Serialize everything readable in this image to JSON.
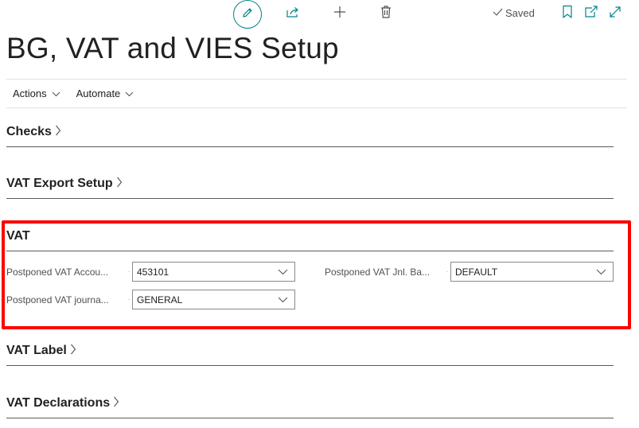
{
  "toolbar": {
    "edit_icon": "pencil-icon",
    "share_icon": "share-icon",
    "new_icon": "plus-icon",
    "delete_icon": "trash-icon",
    "saved_label": "Saved",
    "bookmark_icon": "bookmark-icon",
    "open_window_icon": "open-in-new-window-icon",
    "expand_icon": "expand-icon"
  },
  "page": {
    "title": "BG, VAT and VIES Setup"
  },
  "actions": [
    {
      "label": "Actions"
    },
    {
      "label": "Automate"
    }
  ],
  "sections": {
    "checks": {
      "label": "Checks"
    },
    "vat_export_setup": {
      "label": "VAT Export Setup"
    },
    "vat": {
      "label": "VAT",
      "fields": {
        "postponed_vat_account": {
          "label": "Postponed VAT Accou...",
          "value": "453101"
        },
        "postponed_vat_journal": {
          "label": "Postponed VAT journa...",
          "value": "GENERAL"
        },
        "postponed_vat_jnl_batch": {
          "label": "Postponed VAT Jnl. Ba...",
          "value": "DEFAULT"
        }
      }
    },
    "vat_label": {
      "label": "VAT Label"
    },
    "vat_declarations": {
      "label": "VAT Declarations"
    }
  },
  "colors": {
    "accent": "#008489",
    "highlight": "#ff0000",
    "text": "#212121"
  }
}
